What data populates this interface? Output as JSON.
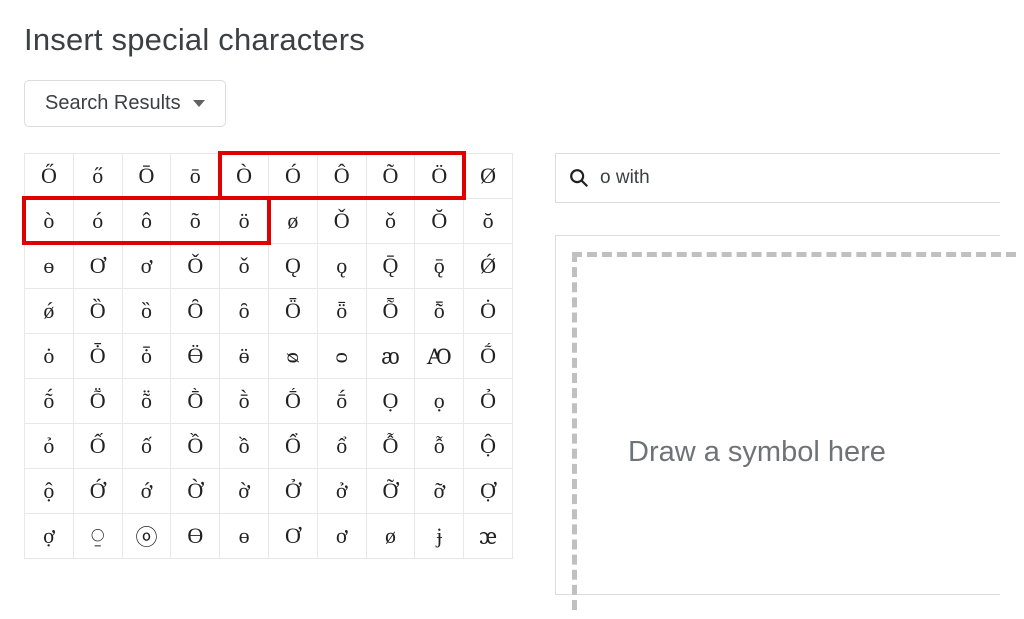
{
  "title": "Insert special characters",
  "dropdown": {
    "label": "Search Results"
  },
  "search": {
    "value": "o with"
  },
  "draw": {
    "placeholder": "Draw a symbol here"
  },
  "grid": [
    [
      "Ő",
      "ő",
      "Ō",
      "ō",
      "Ò",
      "Ó",
      "Ô",
      "Õ",
      "Ö",
      "Ø"
    ],
    [
      "ò",
      "ó",
      "ô",
      "õ",
      "ö",
      "ø",
      "Ǒ",
      "ǒ",
      "Ŏ",
      "ŏ"
    ],
    [
      "ɵ",
      "Ơ",
      "ơ",
      "Ǒ",
      "ǒ",
      "Ǫ",
      "ǫ",
      "Ǭ",
      "ǭ",
      "Ǿ"
    ],
    [
      "ǿ",
      "Ȍ",
      "ȍ",
      "Ȏ",
      "ȏ",
      "Ȫ",
      "ȫ",
      "Ȭ",
      "ȭ",
      "Ȯ"
    ],
    [
      "ȯ",
      "Ȱ",
      "ȱ",
      "Ӫ",
      "ӫ",
      "ᴓ",
      "ᴑ",
      "ꜵ",
      "Ꜵ",
      "Ṍ"
    ],
    [
      "ṍ",
      "Ṏ",
      "ṏ",
      "Ṑ",
      "ṑ",
      "Ṓ",
      "ṓ",
      "Ọ",
      "ọ",
      "Ỏ"
    ],
    [
      "ỏ",
      "Ố",
      "ố",
      "Ồ",
      "ồ",
      "Ổ",
      "ổ",
      "Ỗ",
      "ỗ",
      "Ộ"
    ],
    [
      "ộ",
      "Ớ",
      "ớ",
      "Ờ",
      "ờ",
      "Ở",
      "ở",
      "Ỡ",
      "ỡ",
      "Ợ"
    ],
    [
      "ợ",
      "⍜",
      "ⓞ",
      "Ɵ",
      "ɵ",
      "Ơ",
      "ơ",
      "ø",
      "ɉ",
      "ꭢ"
    ]
  ],
  "highlights": [
    {
      "row": 0,
      "colStart": 4,
      "colEnd": 9
    },
    {
      "row": 1,
      "colStart": 0,
      "colEnd": 5
    }
  ]
}
